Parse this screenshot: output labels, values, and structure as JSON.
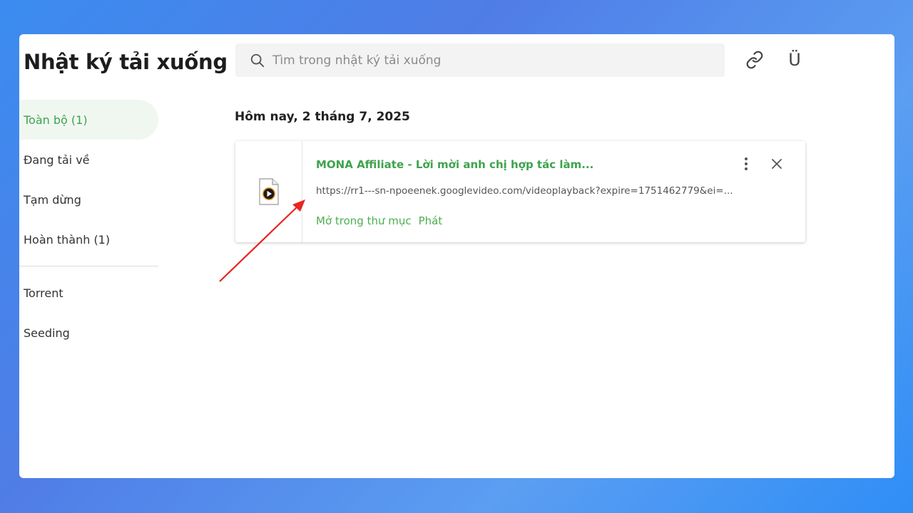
{
  "window": {
    "title": "Nhật ký tải xuống"
  },
  "search": {
    "placeholder": "Tìm trong nhật ký tải xuống",
    "icon": "search-icon"
  },
  "toolbar": {
    "link_icon": "link-icon",
    "magnet_icon": "magnet-icon",
    "magnet_glyph": "Ü"
  },
  "sidebar": {
    "items": [
      {
        "label": "Toàn bộ (1)",
        "active": true
      },
      {
        "label": "Đang tải về",
        "active": false
      },
      {
        "label": "Tạm dừng",
        "active": false
      },
      {
        "label": "Hoàn thành (1)",
        "active": false
      },
      {
        "label": "Torrent",
        "active": false
      },
      {
        "label": "Seeding",
        "active": false
      }
    ]
  },
  "main": {
    "date_heading": "Hôm nay, 2 tháng 7, 2025",
    "downloads": [
      {
        "file_icon": "video-file-icon",
        "name": "MONA Affiliate - Lời mời anh chị hợp tác làm...",
        "url": "https://rr1---sn-npoeenek.googlevideo.com/videoplayback?expire=1751462779&ei=...",
        "actions": [
          "Mở trong thư mục",
          "Phát"
        ]
      }
    ]
  },
  "colors": {
    "accent_green": "#3fa34d",
    "active_bg": "#f0f7f1",
    "annotation_arrow": "#e8251f"
  }
}
